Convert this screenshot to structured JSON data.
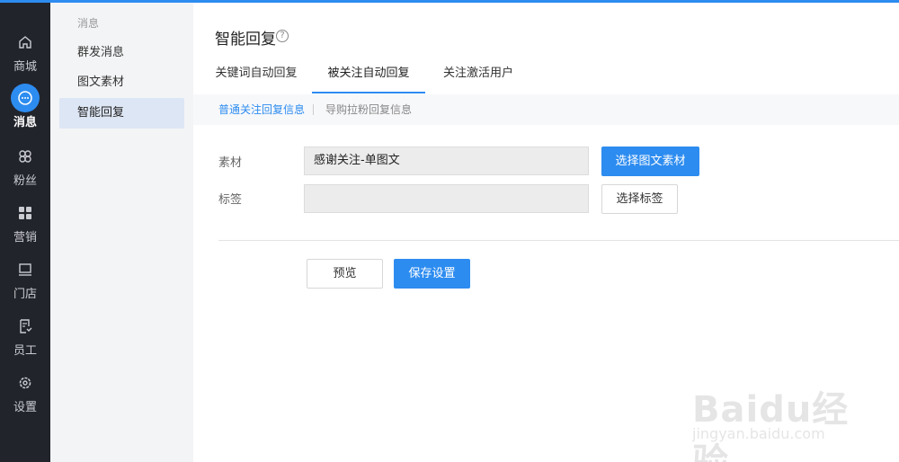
{
  "rail": {
    "items": [
      {
        "label": "商城",
        "icon": "home-icon"
      },
      {
        "label": "消息",
        "icon": "chat-icon",
        "active": true
      },
      {
        "label": "粉丝",
        "icon": "fans-icon"
      },
      {
        "label": "营销",
        "icon": "grid-icon"
      },
      {
        "label": "门店",
        "icon": "monitor-icon"
      },
      {
        "label": "员工",
        "icon": "staff-icon"
      },
      {
        "label": "设置",
        "icon": "gear-icon"
      }
    ]
  },
  "subnav": {
    "group": "消息",
    "items": [
      {
        "label": "群发消息"
      },
      {
        "label": "图文素材"
      },
      {
        "label": "智能回复",
        "active": true
      }
    ]
  },
  "page": {
    "title": "智能回复",
    "help": "?"
  },
  "tabs": [
    {
      "label": "关键词自动回复"
    },
    {
      "label": "被关注自动回复",
      "active": true
    },
    {
      "label": "关注激活用户"
    }
  ],
  "subtabs": [
    {
      "label": "普通关注回复信息",
      "active": true
    },
    {
      "label": "导购拉粉回复信息"
    }
  ],
  "form": {
    "material_label": "素材",
    "material_value": "感谢关注-单图文",
    "select_material_button": "选择图文素材",
    "tag_label": "标签",
    "tag_value": "",
    "select_tag_button": "选择标签",
    "preview_button": "预览",
    "save_button": "保存设置"
  },
  "watermark": {
    "text": "Baidu经验",
    "sub": "jingyan.baidu.com"
  },
  "colors": {
    "accent": "#2d8cf0",
    "rail_bg": "#22242c",
    "subnav_bg": "#f3f4f6",
    "subnav_active": "#dde6f4"
  }
}
